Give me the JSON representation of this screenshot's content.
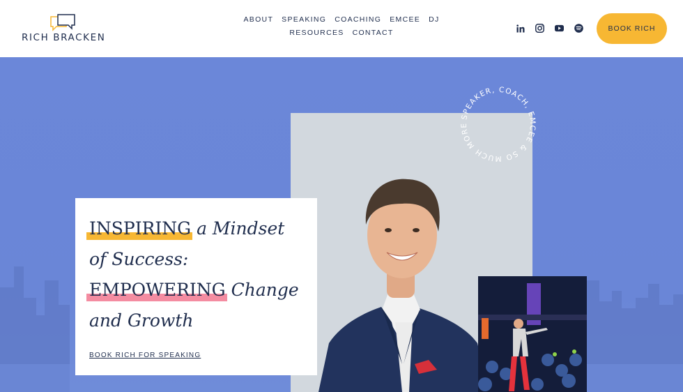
{
  "brand": {
    "name": "RICH BRACKEN"
  },
  "nav": {
    "row1": [
      "ABOUT",
      "SPEAKING",
      "COACHING",
      "EMCEE",
      "DJ"
    ],
    "row2": [
      "RESOURCES",
      "CONTACT"
    ]
  },
  "social": [
    "linkedin-icon",
    "instagram-icon",
    "youtube-icon",
    "spotify-icon"
  ],
  "header": {
    "cta": "BOOK RICH"
  },
  "hero": {
    "circle_text": "SPEAKER, COACH, EMCEE & SO MUCH MORE.",
    "headline": {
      "word1": "INSPIRING",
      "rest1": "a Mindset",
      "line2": "of Success:",
      "word2": "EMPOWERING",
      "rest2": "Change",
      "line4": "and Growth"
    },
    "cta": "BOOK RICH FOR SPEAKING"
  },
  "colors": {
    "accent": "#f7b733",
    "highlight_pink": "#f48ca1",
    "hero_blue": "#6a86d8",
    "navy": "#1f2d4d"
  }
}
